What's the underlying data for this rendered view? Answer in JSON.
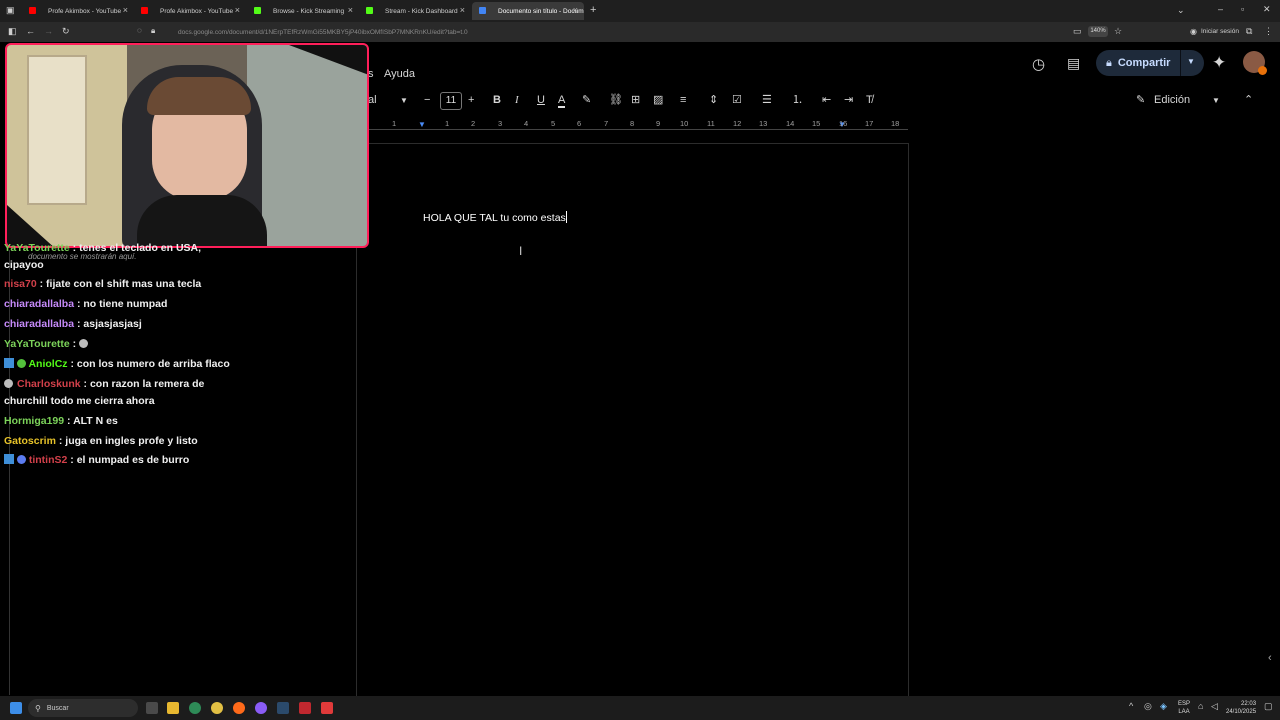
{
  "tabs": [
    {
      "label": "Profe Akimbox - YouTube",
      "color": "#ff0000"
    },
    {
      "label": "Profe Akimbox - YouTube",
      "color": "#ff0000"
    },
    {
      "label": "Browse - Kick Streaming",
      "color": "#53fc18"
    },
    {
      "label": "Stream - Kick Dashboard",
      "color": "#53fc18"
    },
    {
      "label": "Documento sin título - Docum",
      "color": "#4285f4"
    }
  ],
  "url": "docs.google.com/document/d/1NErpTEfRzWmGi55MKBY5jP40ibxOMfISbP7MNKRnKU/edit?tab=t.0",
  "zoom": "140%",
  "sign_in": "Iniciar sesión",
  "menu_help": "Ayuda",
  "menu_partial": "s",
  "share_label": "Compartir",
  "font_partial": "al",
  "font_size": "11",
  "mode_label": "Edición",
  "ruler_numbers": [
    "1",
    "1",
    "2",
    "3",
    "4",
    "5",
    "6",
    "7",
    "8",
    "9",
    "10",
    "11",
    "12",
    "13",
    "14",
    "15",
    "16",
    "17",
    "18"
  ],
  "doc_text": "HOLA QUE TAL tu como estas",
  "overlay_hint": "documento se mostrarán aquí.",
  "chat": [
    {
      "user": "YaYaTourette",
      "user_color": "#7cd35a",
      "msg": "tenes el teclado en USA,",
      "prefix": ""
    },
    {
      "user": "",
      "user_color": "#ffffff",
      "msg": "cipayoo",
      "prefix": ""
    },
    {
      "user": "nisa70",
      "user_color": "#d1404a",
      "msg": "fijate con el shift mas una tecla",
      "prefix": ""
    },
    {
      "user": "chiaradallalba",
      "user_color": "#c58af9",
      "msg": "no tiene numpad",
      "prefix": ""
    },
    {
      "user": "chiaradallalba",
      "user_color": "#c58af9",
      "msg": "asjasjasjasj",
      "prefix": ""
    },
    {
      "user": "YaYaTourette",
      "user_color": "#7cd35a",
      "msg": "",
      "prefix": ""
    },
    {
      "user": "AniolCz",
      "user_color": "#53fc18",
      "msg": "con los numero de arriba flaco",
      "prefix": "badges"
    },
    {
      "user": "Charloskunk",
      "user_color": "#d1404a",
      "msg": "con razon la remera de",
      "prefix": "badge"
    },
    {
      "user": "",
      "user_color": "#ffffff",
      "msg": "churchill todo me cierra ahora",
      "prefix": ""
    },
    {
      "user": "Hormiga199",
      "user_color": "#7cd35a",
      "msg": "ALT N es",
      "prefix": ""
    },
    {
      "user": "Gatoscrim",
      "user_color": "#e6c229",
      "msg": "juga en ingles profe y listo",
      "prefix": ""
    },
    {
      "user": "tintinS2",
      "user_color": "#d1404a",
      "msg": "el numpad es de burro",
      "prefix": "badges"
    }
  ],
  "search_label": "Buscar",
  "lang": {
    "line1": "ESP",
    "line2": "LAA"
  },
  "clock": {
    "time": "22:03",
    "date": "24/10/2025"
  },
  "colors": {
    "accent_share": "#0b57d0",
    "overlay_border": "#ff1f5a",
    "caret": "#ffffff"
  }
}
